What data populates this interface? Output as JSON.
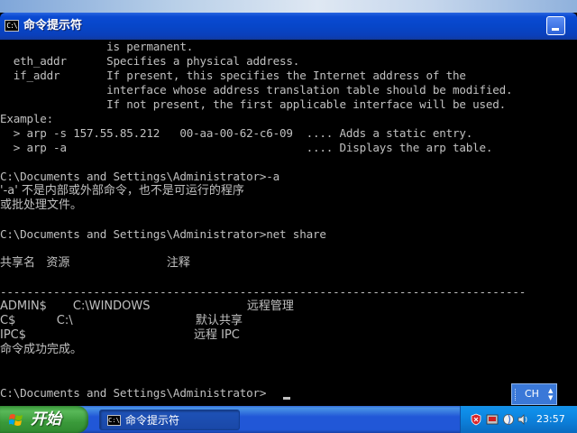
{
  "window": {
    "title": "命令提示符",
    "icon_text": "C:\\"
  },
  "console": {
    "lines": [
      {
        "text": "                is permanent.",
        "cjk": false
      },
      {
        "text": "  eth_addr      Specifies a physical address.",
        "cjk": false
      },
      {
        "text": "  if_addr       If present, this specifies the Internet address of the",
        "cjk": false
      },
      {
        "text": "                interface whose address translation table should be modified.",
        "cjk": false
      },
      {
        "text": "                If not present, the first applicable interface will be used.",
        "cjk": false
      },
      {
        "text": "Example:",
        "cjk": false
      },
      {
        "text": "  > arp -s 157.55.85.212   00-aa-00-62-c6-09  .... Adds a static entry.",
        "cjk": false
      },
      {
        "text": "  > arp -a                                    .... Displays the arp table.",
        "cjk": false
      },
      {
        "text": "",
        "cjk": false
      },
      {
        "text": "C:\\Documents and Settings\\Administrator>-a",
        "cjk": false
      },
      {
        "text": "'-a' 不是内部或外部命令，也不是可运行的程序",
        "cjk": true
      },
      {
        "text": "或批处理文件。",
        "cjk": true
      },
      {
        "text": "",
        "cjk": false
      },
      {
        "text": "C:\\Documents and Settings\\Administrator>net share",
        "cjk": false
      },
      {
        "text": "",
        "cjk": false
      },
      {
        "text": "共享名   资源                          注释",
        "cjk": true
      },
      {
        "text": "",
        "cjk": false
      },
      {
        "text": "-------------------------------------------------------------------------------",
        "cjk": false
      },
      {
        "text": "ADMIN$       C:\\WINDOWS                          远程管理",
        "cjk": true
      },
      {
        "text": "C$           C:\\                                 默认共享",
        "cjk": true
      },
      {
        "text": "IPC$                                             远程 IPC",
        "cjk": true
      },
      {
        "text": "命令成功完成。",
        "cjk": true
      },
      {
        "text": "",
        "cjk": false
      },
      {
        "text": "",
        "cjk": false
      },
      {
        "text": "C:\\Documents and Settings\\Administrator>",
        "cjk": false
      }
    ]
  },
  "ime": {
    "label": "CH"
  },
  "taskbar": {
    "start_label": "开始",
    "task_label": "命令提示符",
    "task_icon_text": "C:\\",
    "clock": "23:57"
  },
  "colors": {
    "console_text": "#c0c0c0",
    "console_bg": "#000000",
    "titlebar": "#0a4ad2",
    "taskbar": "#2157d7",
    "start": "#3a9a3a"
  },
  "icons": [
    "console-icon",
    "minimize-icon",
    "windows-logo-icon",
    "shield-icon",
    "volume-icon",
    "network-icon",
    "app-tray-icon"
  ]
}
